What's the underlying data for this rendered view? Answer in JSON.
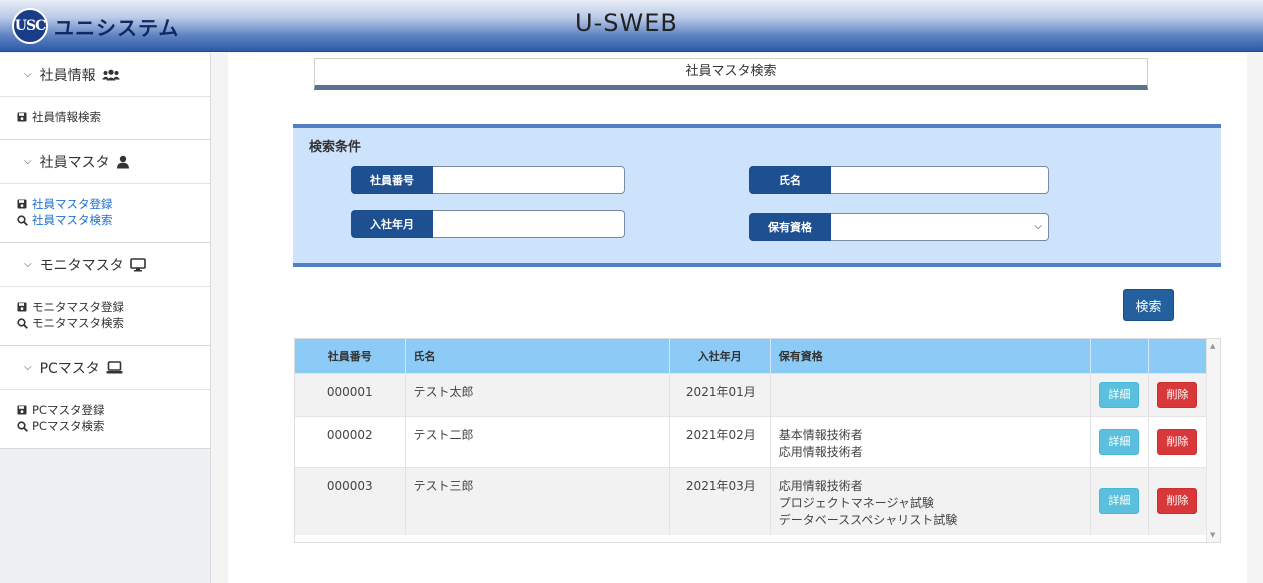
{
  "header": {
    "logo_mark": "USC",
    "logo_text": "ユニシステム",
    "app_title": "U-SWEB"
  },
  "sidebar": {
    "groups": [
      {
        "title": "社員情報",
        "icon": "users-icon",
        "links": [
          {
            "label": "社員情報検索",
            "icon": "save-icon"
          }
        ]
      },
      {
        "title": "社員マスタ",
        "icon": "user-icon",
        "links": [
          {
            "label": "社員マスタ登録",
            "icon": "save-icon"
          },
          {
            "label": "社員マスタ検索",
            "icon": "search-icon"
          }
        ]
      },
      {
        "title": "モニタマスタ",
        "icon": "monitor-icon",
        "links": [
          {
            "label": "モニタマスタ登録",
            "icon": "save-icon"
          },
          {
            "label": "モニタマスタ検索",
            "icon": "search-icon"
          }
        ]
      },
      {
        "title": "PCマスタ",
        "icon": "laptop-icon",
        "links": [
          {
            "label": "PCマスタ登録",
            "icon": "save-icon"
          },
          {
            "label": "PCマスタ検索",
            "icon": "search-icon"
          }
        ]
      }
    ]
  },
  "main": {
    "page_title": "社員マスタ検索",
    "search": {
      "title": "検索条件",
      "employee_no_label": "社員番号",
      "employee_no_value": "",
      "name_label": "氏名",
      "name_value": "",
      "join_label": "入社年月",
      "join_value": "",
      "qual_label": "保有資格",
      "qual_selected": ""
    },
    "search_button": "検索",
    "table": {
      "headers": [
        "社員番号",
        "氏名",
        "入社年月",
        "保有資格",
        "",
        ""
      ],
      "rows": [
        {
          "no": "000001",
          "name": "テスト太郎",
          "joined": "2021年01月",
          "quals": [
            "",
            "",
            ""
          ],
          "detail": "詳細",
          "delete": "削除"
        },
        {
          "no": "000002",
          "name": "テスト二郎",
          "joined": "2021年02月",
          "quals": [
            "基本情報技術者",
            "応用情報技術者",
            ""
          ],
          "detail": "詳細",
          "delete": "削除"
        },
        {
          "no": "000003",
          "name": "テスト三郎",
          "joined": "2021年03月",
          "quals": [
            "応用情報技術者",
            "プロジェクトマネージャ試験",
            "データベーススペシャリスト試験"
          ],
          "detail": "詳細",
          "delete": "削除"
        }
      ]
    }
  },
  "colors": {
    "header_dark": "#2c5aa6",
    "panel_bg": "#cde2fb",
    "label_bg": "#1d4f91",
    "table_head": "#8ccbf5",
    "detail_btn": "#5bc0de",
    "delete_btn": "#d9383a",
    "link_blue": "#1e6fd0"
  }
}
